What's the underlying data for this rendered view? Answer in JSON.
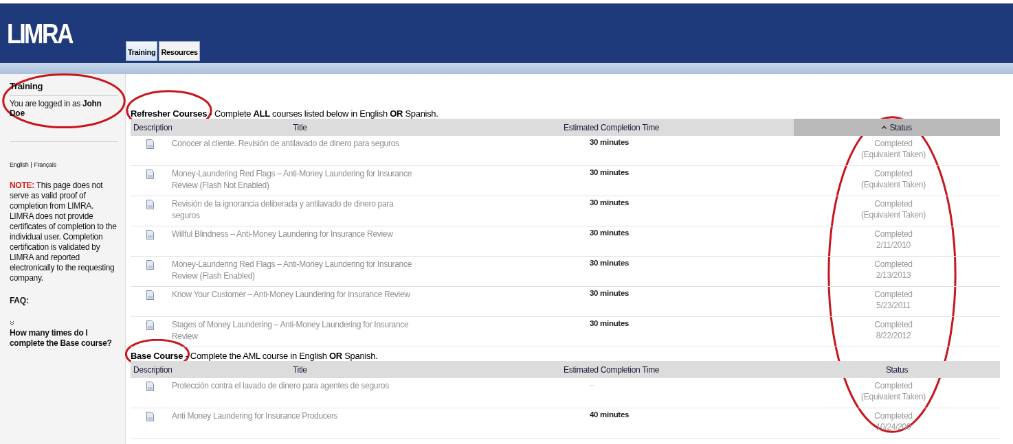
{
  "header": {
    "logo": "LIMRA",
    "tabs": [
      {
        "label": "Training",
        "selected": true
      },
      {
        "label": "Resources",
        "selected": false
      }
    ]
  },
  "sidebar": {
    "title": "Training",
    "circled": true,
    "login": "You are logged in as **John Doe**",
    "languages": [
      "English",
      "Français"
    ],
    "separator": "|",
    "note_label": "NOTE:",
    "note": "This page does not serve as valid proof of completion from LIMRA. LIMRA does not provide certificates of completion to the individual user. Completion certification is validated by LIMRA and reported electronically to the requesting company.",
    "faq_label": "FAQ:",
    "faq_items": [
      {
        "question": "How many times do I complete the Base course?",
        "expanded": false
      }
    ]
  },
  "sections": [
    {
      "heading": "**Refresher Courses** - Complete **ALL** courses listed below in English **OR** Spanish.",
      "circled": true,
      "columns": [
        {
          "label": "Description",
          "sorted": false
        },
        {
          "label": "Title",
          "sorted": false
        },
        {
          "label": "Estimated Completion Time",
          "sorted": false
        },
        {
          "label": "Status",
          "sorted": true,
          "circled": true
        }
      ],
      "rows": [
        {
          "title": "Conocer al cliente. Revisión de antilavado de dinero para seguros",
          "time": "30 minutes",
          "status": "Completed",
          "detail": "(Equivalent Taken)"
        },
        {
          "title": "Money-Laundering Red Flags – Anti-Money Laundering for Insurance Review (Flash Not Enabled)",
          "time": "30 minutes",
          "status": "Completed",
          "detail": "(Equivalent Taken)"
        },
        {
          "title": "Revisión de la ignorancia deliberada y antilavado de dinero para seguros",
          "time": "30 minutes",
          "status": "Completed",
          "detail": "(Equivalent Taken)"
        },
        {
          "title": "Willful Blindness – Anti-Money Laundering for Insurance Review",
          "time": "30 minutes",
          "status": "Completed",
          "detail": "2/11/2010"
        },
        {
          "title": "Money-Laundering Red Flags – Anti-Money Laundering for Insurance Review (Flash Enabled)",
          "time": "30 minutes",
          "status": "Completed",
          "detail": "2/13/2013"
        },
        {
          "title": "Know Your Customer – Anti-Money Laundering for Insurance Review",
          "time": "30 minutes",
          "status": "Completed",
          "detail": "5/23/2011"
        },
        {
          "title": "Stages of Money Laundering – Anti-Money Laundering for Insurance Review",
          "time": "30 minutes",
          "status": "Completed",
          "detail": "8/22/2012"
        }
      ]
    },
    {
      "heading": "**Base Course** - Complete the AML course in English **OR** Spanish.",
      "circled": true,
      "columns": [
        {
          "label": "Description",
          "sorted": false
        },
        {
          "label": "Title",
          "sorted": false
        },
        {
          "label": "Estimated Completion Time",
          "sorted": false
        },
        {
          "label": "Status",
          "sorted": false
        }
      ],
      "rows": [
        {
          "title": "Protección contra el lavado de dinero para agentes de seguros",
          "time": "–",
          "status": "Completed",
          "detail": "(Equivalent Taken)"
        },
        {
          "title": "Anti Money Laundering for Insurance Producers",
          "time": "40 minutes",
          "status": "Completed",
          "detail": "10/24/200"
        }
      ]
    }
  ]
}
